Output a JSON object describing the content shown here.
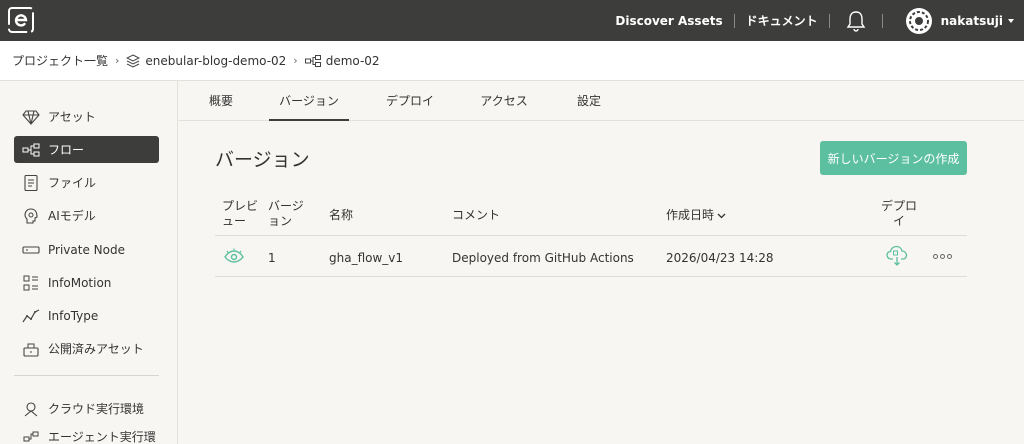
{
  "header": {
    "logo_icon": "enebular-logo-icon",
    "discover_label": "Discover Assets",
    "docs_label": "ドキュメント",
    "bell_icon": "bell-icon",
    "username": "nakatsuji"
  },
  "breadcrumb": {
    "root": "プロジェクト一覧",
    "project": "enebular-blog-demo-02",
    "flow": "demo-02"
  },
  "sidebar": {
    "items": [
      {
        "label": "アセット",
        "icon": "diamond-icon"
      },
      {
        "label": "フロー",
        "icon": "flow-icon",
        "active": true
      },
      {
        "label": "ファイル",
        "icon": "file-icon"
      },
      {
        "label": "AIモデル",
        "icon": "ai-model-icon"
      },
      {
        "label": "Private Node",
        "icon": "private-node-icon"
      },
      {
        "label": "InfoMotion",
        "icon": "infomotion-icon"
      },
      {
        "label": "InfoType",
        "icon": "infotype-icon"
      },
      {
        "label": "公開済みアセット",
        "icon": "published-asset-icon"
      },
      {
        "label": "クラウド実行環境",
        "icon": "cloud-execution-icon"
      },
      {
        "label": "エージェント実行環",
        "icon": "agent-execution-icon"
      }
    ]
  },
  "tabs": [
    {
      "label": "概要"
    },
    {
      "label": "バージョン",
      "active": true
    },
    {
      "label": "デプロイ"
    },
    {
      "label": "アクセス"
    },
    {
      "label": "設定"
    }
  ],
  "main": {
    "title": "バージョン",
    "create_button": "新しいバージョンの作成"
  },
  "table": {
    "headers": {
      "preview_l1": "プレビ",
      "preview_l2": "ュー",
      "version_l1": "バージ",
      "version_l2": "ョン",
      "name": "名称",
      "comment": "コメント",
      "created": "作成日時",
      "deploy_l1": "デプロ",
      "deploy_l2": "イ"
    },
    "rows": [
      {
        "version": "1",
        "name": "gha_flow_v1",
        "comment": "Deployed from GitHub Actions",
        "created": "2026/04/23 14:28"
      }
    ]
  },
  "colors": {
    "topbar": "#3d3d3b",
    "accent": "#5cbfa0",
    "background": "#f7f6f2"
  }
}
